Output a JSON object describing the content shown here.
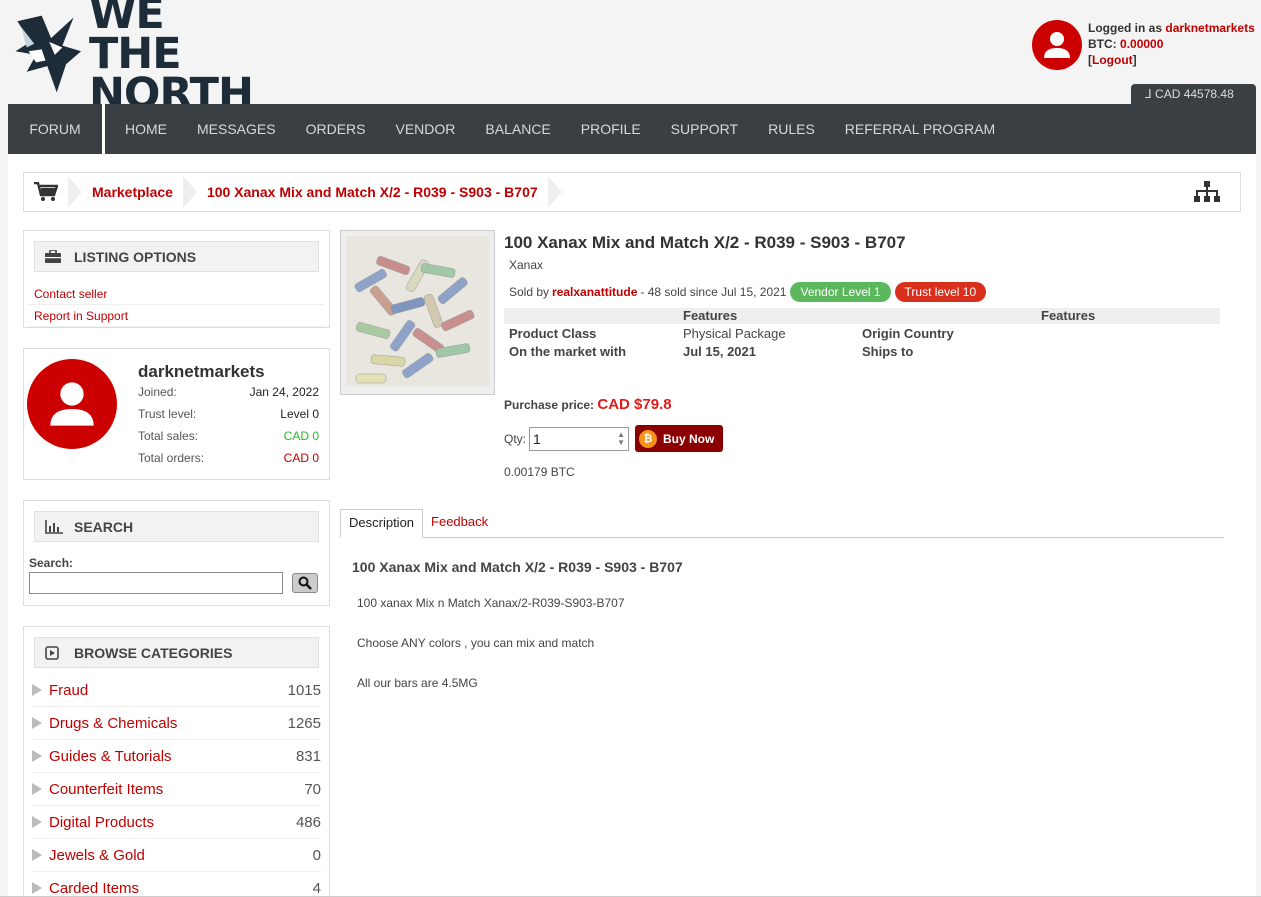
{
  "header": {
    "logo_text_line1": "WE THE",
    "logo_text_line2": "NORTH",
    "logged_in_prefix": "Logged in as",
    "username": "darknetmarkets",
    "btc_label": "BTC:",
    "btc_balance": "0.00000",
    "logout_open": "[",
    "logout_label": "Logout",
    "logout_close": "]",
    "cad_balance": "CAD 44578.48"
  },
  "nav": {
    "forum": "FORUM",
    "items": [
      "HOME",
      "MESSAGES",
      "ORDERS",
      "VENDOR",
      "BALANCE",
      "PROFILE",
      "SUPPORT",
      "RULES",
      "REFERRAL PROGRAM"
    ]
  },
  "breadcrumb": {
    "items": [
      "Marketplace",
      "100 Xanax Mix and Match X/2 - R039 - S903 - B707"
    ]
  },
  "listing_options": {
    "title": "LISTING OPTIONS",
    "links": [
      "Contact seller",
      "Report in Support"
    ]
  },
  "profile": {
    "name": "darknetmarkets",
    "rows": [
      {
        "label": "Joined:",
        "value": "Jan 24, 2022"
      },
      {
        "label": "Trust level:",
        "value": "Level 0"
      },
      {
        "label": "Total sales:",
        "value": "CAD 0"
      },
      {
        "label": "Total orders:",
        "value": "CAD 0"
      }
    ]
  },
  "search": {
    "title": "SEARCH",
    "label": "Search:",
    "value": ""
  },
  "categories": {
    "title": "BROWSE CATEGORIES",
    "items": [
      {
        "name": "Fraud",
        "count": "1015"
      },
      {
        "name": "Drugs & Chemicals",
        "count": "1265"
      },
      {
        "name": "Guides & Tutorials",
        "count": "831"
      },
      {
        "name": "Counterfeit Items",
        "count": "70"
      },
      {
        "name": "Digital Products",
        "count": "486"
      },
      {
        "name": "Jewels & Gold",
        "count": "0"
      },
      {
        "name": "Carded Items",
        "count": "4"
      }
    ]
  },
  "listing": {
    "title": "100 Xanax Mix and Match X/2 - R039 - S903 - B707",
    "subcategory": "Xanax",
    "sold_by_label": "Sold by",
    "vendor": "realxanattitude",
    "sold_info": "- 48 sold since Jul 15, 2021",
    "vendor_badge": "Vendor Level 1",
    "trust_badge": "Trust level 10",
    "features_header_1": "Features",
    "features_header_2": "Features",
    "product_class_label": "Product Class",
    "product_class_value": "Physical Package",
    "origin_label": "Origin Country",
    "origin_value": "",
    "market_label": "On the market with",
    "market_value": "Jul 15, 2021",
    "ships_label": "Ships to",
    "ships_value": "",
    "price_label": "Purchase price:",
    "price": "CAD $79.8",
    "qty_label": "Qty:",
    "qty_value": "1",
    "buy_label": "Buy Now",
    "btc_price": "0.00179 BTC"
  },
  "tabs": [
    "Description",
    "Feedback"
  ],
  "description": {
    "title": "100 Xanax Mix and Match X/2 - R039 - S903 - B707",
    "lines": [
      "100 xanax Mix n Match Xanax/2-R039-S903-B707",
      "Choose ANY colors , you can mix and match",
      "All our bars are 4.5MG"
    ]
  },
  "colors": {
    "accent_red": "#c00000",
    "nav_bg": "#3a3f44",
    "vendor_badge": "#5cb85c",
    "trust_badge": "#d9301e",
    "btc_orange": "#f7931a"
  }
}
